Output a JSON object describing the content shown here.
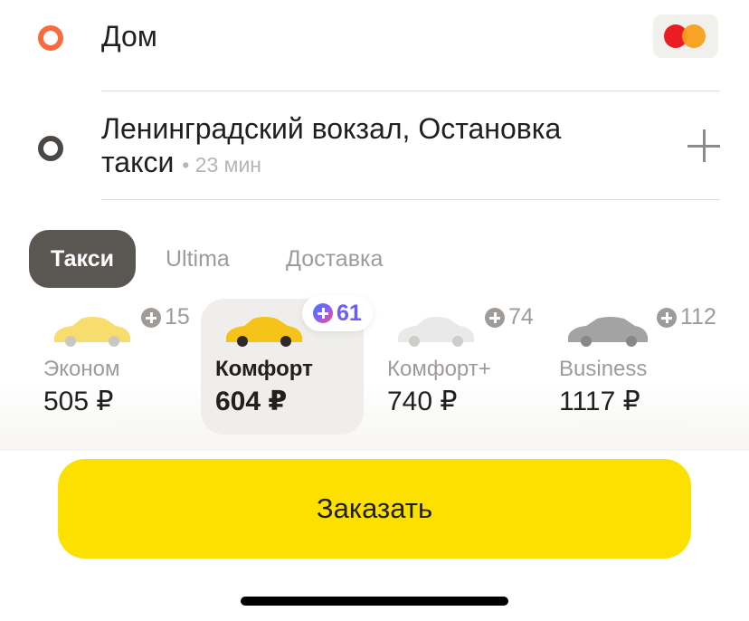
{
  "route": {
    "origin": "Дом",
    "destination": "Ленинградский вокзал, Остановка",
    "destination_line2": "такси",
    "eta": "• 23 мин"
  },
  "tabs": [
    {
      "label": "Такси",
      "active": true
    },
    {
      "label": "Ultima",
      "active": false
    },
    {
      "label": "Доставка",
      "active": false
    }
  ],
  "tariffs": [
    {
      "name": "Эконом",
      "price": "505 ₽",
      "plus": "15",
      "car_color": "#f7dd6d"
    },
    {
      "name": "Комфорт",
      "price": "604 ₽",
      "plus": "61",
      "car_color": "#f6c419",
      "selected": true
    },
    {
      "name": "Комфорт+",
      "price": "740 ₽",
      "plus": "74",
      "car_color": "#e9e9e9"
    },
    {
      "name": "Business",
      "price": "1117 ₽",
      "plus": "112",
      "car_color": "#a3a3a3"
    }
  ],
  "order_button": "Заказать",
  "colors": {
    "accent": "#fce000",
    "origin_pin": "#fa6a3c",
    "active_tab": "#5a5753"
  },
  "icons": {
    "payment": "mastercard-icon",
    "add_stop": "plus-icon",
    "plus_points": "yandex-plus-icon"
  }
}
